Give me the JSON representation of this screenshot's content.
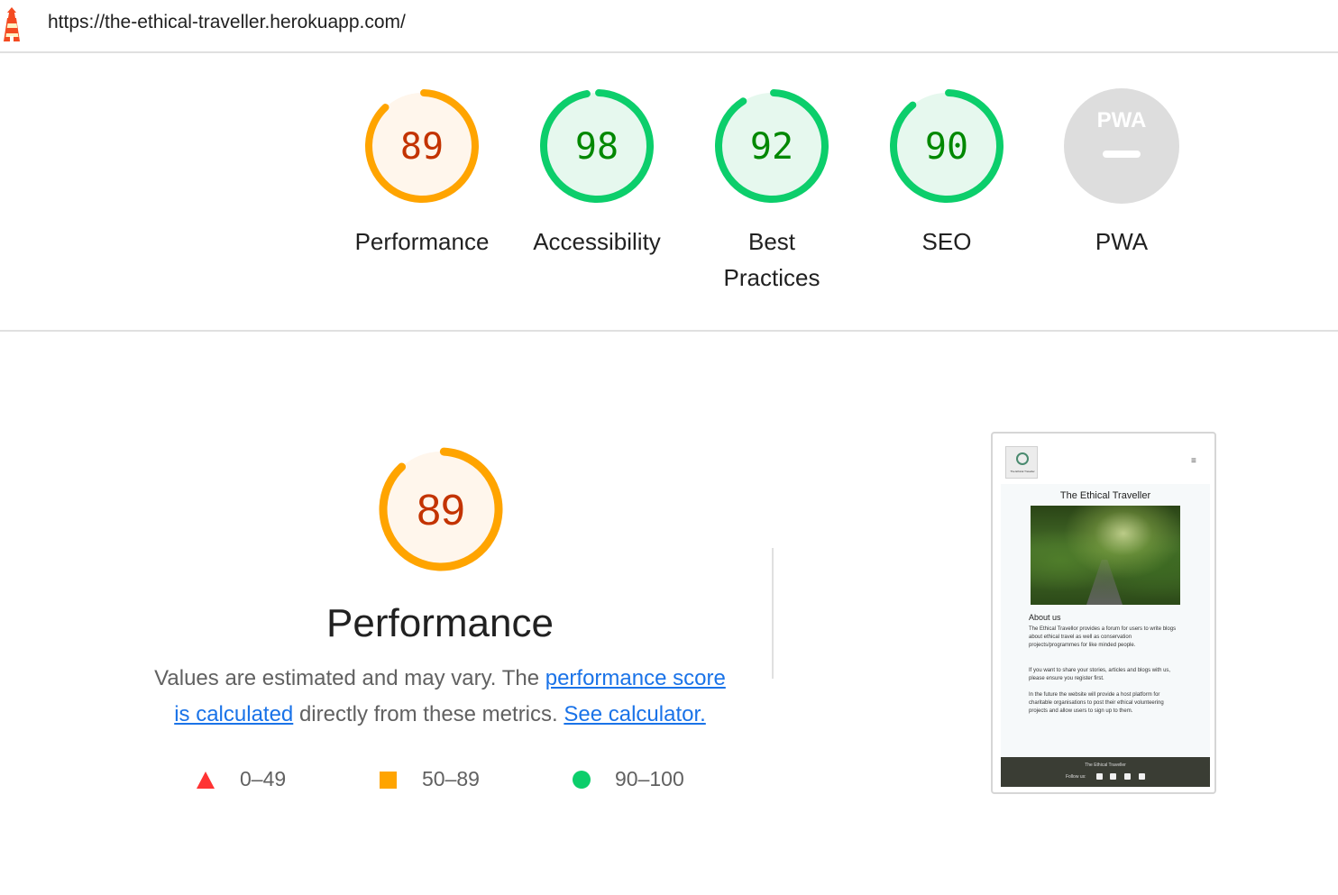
{
  "header": {
    "url": "https://the-ethical-traveller.herokuapp.com/",
    "logo_icon": "lighthouse-icon"
  },
  "colors": {
    "fail": "#ff3333",
    "average": "#ffa400",
    "pass": "#0cce6b",
    "average_text": "#c33300",
    "pass_text": "#008800",
    "link": "#1a73e8"
  },
  "scores": [
    {
      "label": "Performance",
      "score": "89",
      "value": 0.89,
      "rating": "average"
    },
    {
      "label": "Accessibility",
      "score": "98",
      "value": 0.98,
      "rating": "pass"
    },
    {
      "label": "Best Practices",
      "score": "92",
      "value": 0.92,
      "rating": "pass"
    },
    {
      "label": "SEO",
      "score": "90",
      "value": 0.9,
      "rating": "pass"
    },
    {
      "label": "PWA",
      "badge_text": "PWA",
      "rating": "na"
    }
  ],
  "performance": {
    "score": "89",
    "value": 0.89,
    "title": "Performance",
    "desc_prefix": "Values are estimated and may vary. The ",
    "link1": "performance score is calculated",
    "desc_middle": " directly from these metrics. ",
    "link2": "See calculator."
  },
  "legend": [
    {
      "range": "0–49",
      "shape": "triangle",
      "rating": "fail"
    },
    {
      "range": "50–89",
      "shape": "square",
      "rating": "average"
    },
    {
      "range": "90–100",
      "shape": "circle",
      "rating": "pass"
    }
  ],
  "thumbnail": {
    "logo_text": "The Ethical Traveller",
    "menu_icon": "hamburger-menu-icon",
    "title": "The Ethical Traveller",
    "about_heading": "About us",
    "paragraphs": [
      "The Ethical Travellor provides a forum for users to write blogs about ethical travel as well as conservation projects/programmes for like minded people.",
      "If you want to share your stories, articles and blogs with us, please ensure you register first.",
      "In the future the website will provide a host platform for charitable organisations to post their ethical volunteering projects and allow users to sign up to them."
    ],
    "footer_title": "The Ethical Traveller",
    "footer_follow": "Follow us:",
    "social_icons": [
      "facebook-icon",
      "twitter-icon",
      "instagram-icon",
      "youtube-icon"
    ]
  }
}
